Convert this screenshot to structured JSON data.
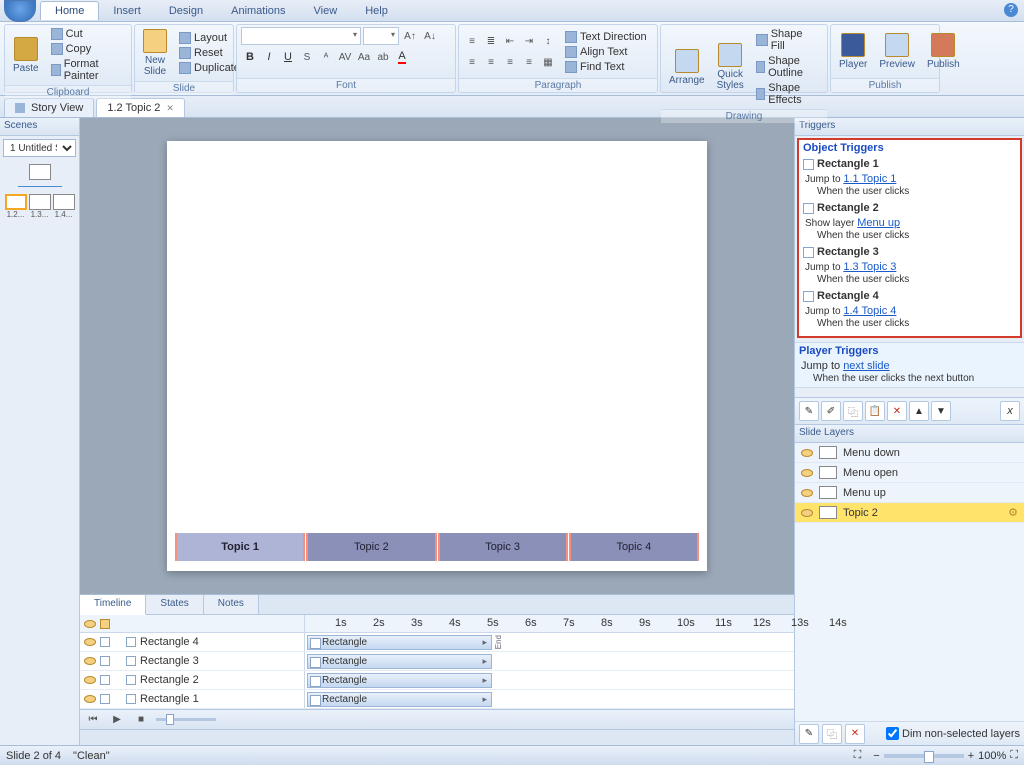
{
  "menus": {
    "home": "Home",
    "insert": "Insert",
    "design": "Design",
    "anim": "Animations",
    "view": "View",
    "help": "Help"
  },
  "ribbon": {
    "clipboard": {
      "title": "Clipboard",
      "paste": "Paste",
      "cut": "Cut",
      "copy": "Copy",
      "fmt": "Format Painter"
    },
    "slide": {
      "title": "Slide",
      "new": "New\nSlide",
      "layout": "Layout",
      "reset": "Reset",
      "dup": "Duplicate"
    },
    "font": {
      "title": "Font"
    },
    "para": {
      "title": "Paragraph",
      "tdir": "Text Direction",
      "align": "Align Text",
      "find": "Find Text"
    },
    "draw": {
      "title": "Drawing",
      "arr": "Arrange",
      "qs": "Quick\nStyles",
      "fill": "Shape Fill",
      "outline": "Shape Outline",
      "fx": "Shape Effects"
    },
    "publish": {
      "title": "Publish",
      "player": "Player",
      "preview": "Preview",
      "pub": "Publish"
    }
  },
  "doctabs": {
    "story": "Story View",
    "current": "1.2 Topic 2"
  },
  "scenes": {
    "title": "Scenes",
    "sel": "1 Untitled S...",
    "l1": "1.2...",
    "l2": "1.3...",
    "l3": "1.4..."
  },
  "topics": {
    "t1": "Topic 1",
    "t2": "Topic 2",
    "t3": "Topic 3",
    "t4": "Topic 4"
  },
  "timeline": {
    "tabs": {
      "tl": "Timeline",
      "states": "States",
      "notes": "Notes"
    },
    "ticks": [
      "1s",
      "2s",
      "3s",
      "4s",
      "5s",
      "6s",
      "7s",
      "8s",
      "9s",
      "10s",
      "11s",
      "12s",
      "13s",
      "14s"
    ],
    "end": "End",
    "rows": [
      {
        "name": "Rectangle 4",
        "bar": "Rectangle"
      },
      {
        "name": "Rectangle 3",
        "bar": "Rectangle"
      },
      {
        "name": "Rectangle 2",
        "bar": "Rectangle"
      },
      {
        "name": "Rectangle 1",
        "bar": "Rectangle"
      }
    ]
  },
  "triggers": {
    "title": "Triggers",
    "objhdr": "Object Triggers",
    "items": [
      {
        "obj": "Rectangle 1",
        "act": "Jump to ",
        "link": "1.1 Topic 1",
        "cond": "When the user clicks"
      },
      {
        "obj": "Rectangle 2",
        "act": "Show layer ",
        "link": "Menu up",
        "cond": "When the user clicks"
      },
      {
        "obj": "Rectangle 3",
        "act": "Jump to ",
        "link": "1.3 Topic 3",
        "cond": "When the user clicks"
      },
      {
        "obj": "Rectangle 4",
        "act": "Jump to ",
        "link": "1.4 Topic 4",
        "cond": "When the user clicks"
      }
    ],
    "playerhdr": "Player Triggers",
    "pact": "Jump to ",
    "plink": "next slide",
    "pcond": "When the user clicks the next button"
  },
  "layers": {
    "title": "Slide Layers",
    "items": [
      "Menu down",
      "Menu open",
      "Menu up",
      "Topic 2"
    ],
    "dim": "Dim non-selected layers"
  },
  "status": {
    "slide": "Slide 2 of 4",
    "theme": "\"Clean\"",
    "zoom": "100%"
  }
}
